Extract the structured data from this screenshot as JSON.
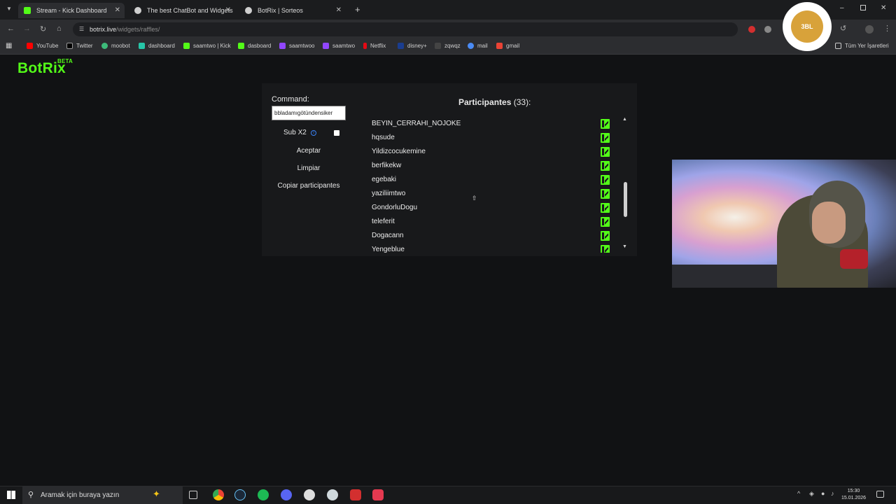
{
  "browser": {
    "tabs": [
      {
        "title": "Stream - Kick Dashboard",
        "color": "#53fc18"
      },
      {
        "title": "The best ChatBot and Widgets",
        "color": "#cccccc"
      },
      {
        "title": "BotRix | Sorteos",
        "color": "#cccccc"
      }
    ],
    "url_host": "botrix.live",
    "url_path": "/widgets/raffles/",
    "bookmarks": [
      "YouTube",
      "Twitter",
      "moobot",
      "dashboard",
      "saamtwo | Kick",
      "dasboard",
      "saamtwoo",
      "saamtwo",
      "Netflix",
      "disney+",
      "zqwqz",
      "mail",
      "gmail"
    ],
    "bookmark_folder": "Tüm Yer İşaretleri"
  },
  "app": {
    "logo": "BotRix",
    "logo_badge": "BETA"
  },
  "raffle": {
    "command_label": "Command:",
    "command_value": "bbladamıgötündensiker",
    "sub_label": "Sub X2",
    "sub_checked": false,
    "accept_button": "Aceptar",
    "clear_button": "Limpiar",
    "copy_button": "Copiar participantes",
    "participants_title": "Participantes",
    "participants_count": "(33):",
    "participants": [
      "BEYIN_CERRAHI_NOJOKE",
      "hqsude",
      "Yildizcocukemine",
      "berfikekw",
      "egebaki",
      "yaziliimtwo",
      "GondorluDogu",
      "teleferit",
      "Dogacann",
      "Yengeblue"
    ],
    "platform_icon": "kick-icon"
  },
  "avatar_text": "3BL",
  "taskbar": {
    "search_placeholder": "Aramak için buraya yazın",
    "time": "15:30",
    "date": "15.01.2026"
  },
  "colors": {
    "accent": "#53fc18",
    "background": "#111214",
    "panel": "#18191b"
  }
}
